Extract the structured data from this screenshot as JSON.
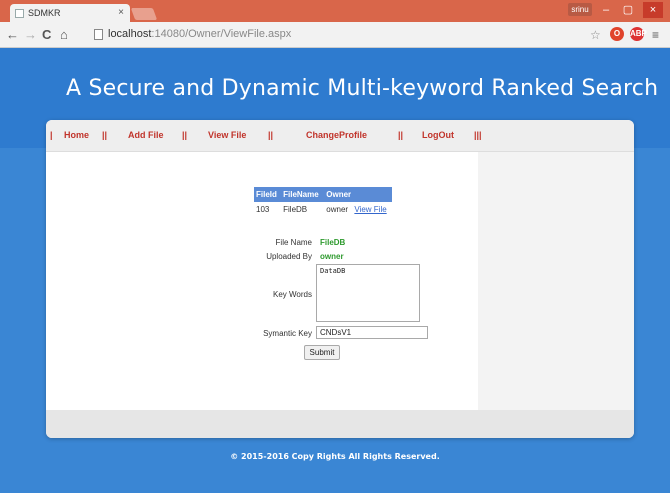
{
  "browser": {
    "tab_title": "SDMKR",
    "tab_close": "×",
    "user_badge": "srinu",
    "url_host": "localhost",
    "url_path": ":14080/Owner/ViewFile.aspx",
    "window_controls": [
      "–",
      "▢",
      "×"
    ],
    "nav_icons": [
      "back-icon",
      "forward-icon",
      "reload-icon",
      "home-icon"
    ]
  },
  "header": {
    "title": "A Secure and Dynamic Multi-keyword Ranked Search"
  },
  "menu": {
    "items": [
      "Home",
      "Add File",
      "View File",
      "ChangeProfile",
      "LogOut"
    ],
    "separator": "||",
    "lead": "|",
    "trail": "|||"
  },
  "file_table": {
    "headers": [
      "FileId",
      "FileName",
      "Owner"
    ],
    "rows": [
      {
        "file_id": "103",
        "file_name": "FileDB",
        "owner": "owner",
        "action": "View File"
      }
    ]
  },
  "form": {
    "file_name_label": "File Name",
    "file_name_value": "FileDB",
    "uploaded_by_label": "Uploaded By",
    "uploaded_by_value": "owner",
    "keywords_label": "Key Words",
    "keywords_value": "DataDB",
    "symantic_key_label": "Symantic Key",
    "symantic_key_value": "CNDsV1",
    "submit_label": "Submit"
  },
  "footer": {
    "copyright": "© 2015-2016 Copy Rights All Rights Reserved."
  },
  "colors": {
    "header_blue": "#2e7bcf",
    "menu_red": "#c1342b",
    "table_header": "#5a8bd6",
    "value_green": "#2e9a2e",
    "titlebar": "#d9664a"
  }
}
